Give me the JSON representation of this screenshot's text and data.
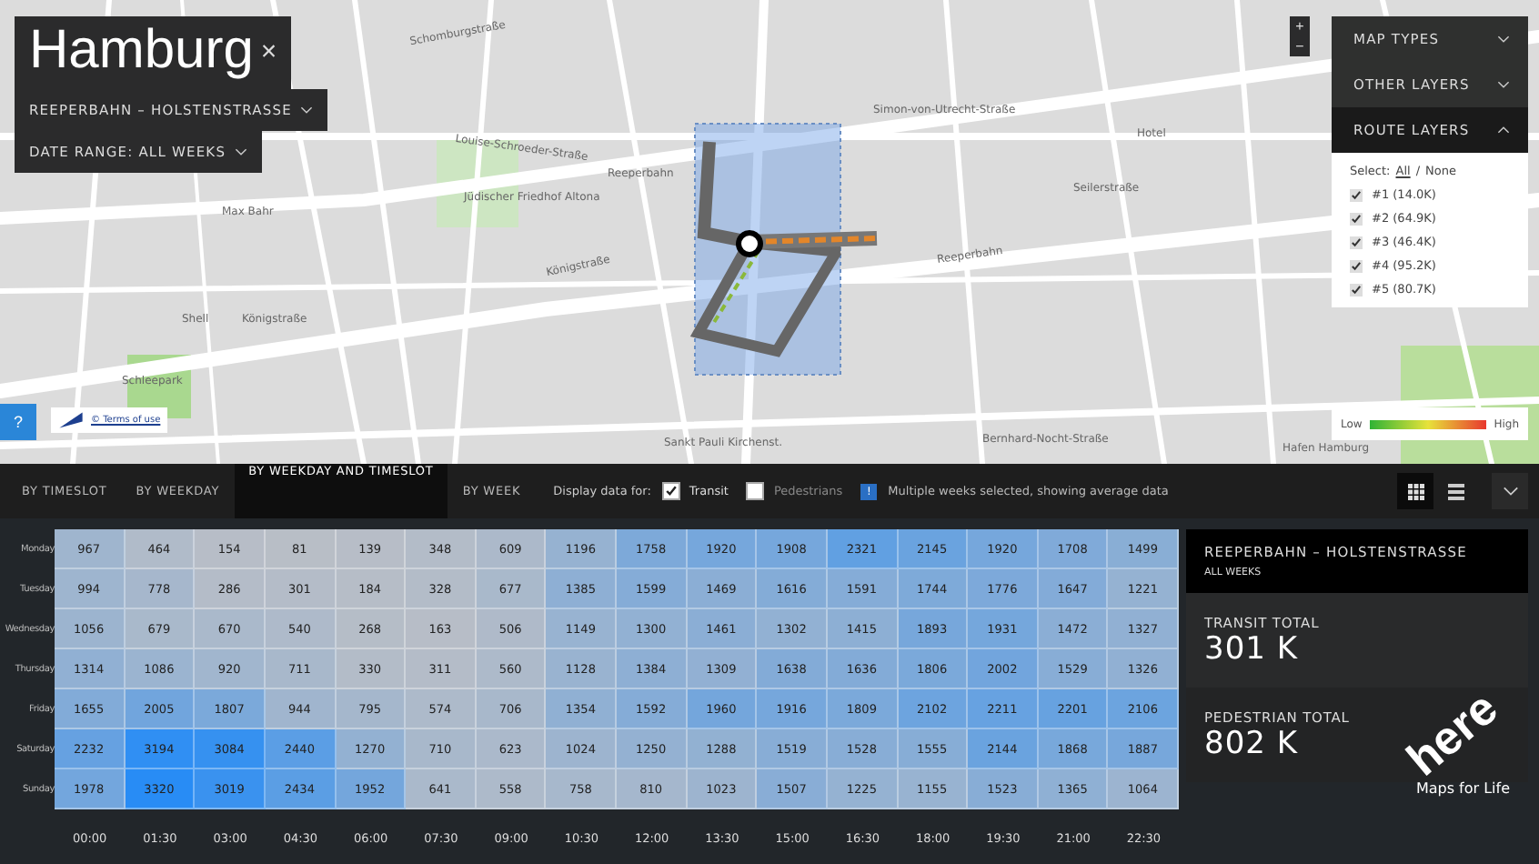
{
  "city": {
    "title": "Hamburg",
    "close": "×"
  },
  "route_dropdown": {
    "value": "REEPERBAHN – HOLSTENSTRASSE"
  },
  "date_dropdown": {
    "label": "DATE RANGE:",
    "value": "ALL WEEKS"
  },
  "map_labels": [
    "Schomburgstraße",
    "Louise-Schroeder-Straße",
    "Jüdischer Friedhof Altona",
    "Max Bahr",
    "Königstraße",
    "Shell",
    "Schleepark",
    "Königstraße",
    "Reeperbahn",
    "Simon-von-Utrecht-Straße",
    "Hotel",
    "Seilerstraße",
    "Reeperbahn",
    "Sankt Pauli Kirchenst.",
    "Bernhard-Nocht-Straße",
    "Hafen Hamburg"
  ],
  "zoom_controls": [
    "+",
    "−"
  ],
  "layer_menu": [
    {
      "label": "MAP TYPES",
      "expanded": false
    },
    {
      "label": "OTHER LAYERS",
      "expanded": false
    },
    {
      "label": "ROUTE LAYERS",
      "expanded": true
    }
  ],
  "route_select": {
    "label": "Select:",
    "all": "All",
    "separator": "/",
    "none": "None"
  },
  "routes": [
    {
      "label": "#1 (14.0K)",
      "checked": true
    },
    {
      "label": "#2 (64.9K)",
      "checked": true
    },
    {
      "label": "#3 (46.4K)",
      "checked": true
    },
    {
      "label": "#4 (95.2K)",
      "checked": true
    },
    {
      "label": "#5 (80.7K)",
      "checked": true
    }
  ],
  "legend": {
    "low": "Low",
    "high": "High"
  },
  "help_button": "?",
  "terms_link": "© Terms of use",
  "tabs": [
    {
      "label": "BY TIMESLOT",
      "selected": false
    },
    {
      "label": "BY WEEKDAY",
      "selected": false
    },
    {
      "label": "BY WEEKDAY AND TIMESLOT",
      "selected": true
    },
    {
      "label": "BY WEEK",
      "selected": false
    }
  ],
  "display_for": {
    "label": "Display data for:",
    "options": [
      {
        "label": "Transit",
        "checked": true
      },
      {
        "label": "Pedestrians",
        "checked": false
      }
    ]
  },
  "notice": {
    "icon": "!",
    "text": "Multiple weeks selected, showing average data"
  },
  "view_toggle": [
    {
      "kind": "grid",
      "selected": true
    },
    {
      "kind": "list",
      "selected": false
    }
  ],
  "heatmap": {
    "rows": [
      {
        "day": "Monday",
        "values": [
          "967",
          "464",
          "154",
          "81",
          "139",
          "348",
          "609",
          "1196",
          "1758",
          "1920",
          "1908",
          "2321",
          "2145",
          "1920",
          "1708",
          "1499"
        ]
      },
      {
        "day": "Tuesday",
        "values": [
          "994",
          "778",
          "286",
          "301",
          "184",
          "328",
          "677",
          "1385",
          "1599",
          "1469",
          "1616",
          "1591",
          "1744",
          "1776",
          "1647",
          "1221"
        ]
      },
      {
        "day": "Wednesday",
        "values": [
          "1056",
          "679",
          "670",
          "540",
          "268",
          "163",
          "506",
          "1149",
          "1300",
          "1461",
          "1302",
          "1415",
          "1893",
          "1931",
          "1472",
          "1327"
        ]
      },
      {
        "day": "Thursday",
        "values": [
          "1314",
          "1086",
          "920",
          "711",
          "330",
          "311",
          "560",
          "1128",
          "1384",
          "1309",
          "1638",
          "1636",
          "1806",
          "2002",
          "1529",
          "1326"
        ]
      },
      {
        "day": "Friday",
        "values": [
          "1655",
          "2005",
          "1807",
          "944",
          "795",
          "574",
          "706",
          "1354",
          "1592",
          "1960",
          "1916",
          "1809",
          "2102",
          "2211",
          "2201",
          "2106"
        ]
      },
      {
        "day": "Saturday",
        "values": [
          "2232",
          "3194",
          "3084",
          "2440",
          "1270",
          "710",
          "623",
          "1024",
          "1250",
          "1288",
          "1519",
          "1528",
          "1555",
          "2144",
          "1868",
          "1887"
        ]
      },
      {
        "day": "Sunday",
        "values": [
          "1978",
          "3320",
          "3019",
          "2434",
          "1952",
          "641",
          "558",
          "758",
          "810",
          "1023",
          "1507",
          "1225",
          "1155",
          "1523",
          "1365",
          "1064"
        ]
      }
    ],
    "times": [
      "00:00",
      "01:30",
      "03:00",
      "04:30",
      "06:00",
      "07:30",
      "09:00",
      "10:30",
      "12:00",
      "13:30",
      "15:00",
      "16:30",
      "18:00",
      "19:30",
      "21:00",
      "22:30"
    ]
  },
  "summary": {
    "route": "REEPERBAHN – HOLSTENSTRASSE",
    "period": "ALL WEEKS",
    "totals": [
      {
        "label": "TRANSIT TOTAL",
        "value": "301 K"
      },
      {
        "label": "PEDESTRIAN TOTAL",
        "value": "802 K"
      }
    ]
  },
  "brand": {
    "logo": "here",
    "tagline": "Maps for Life"
  }
}
